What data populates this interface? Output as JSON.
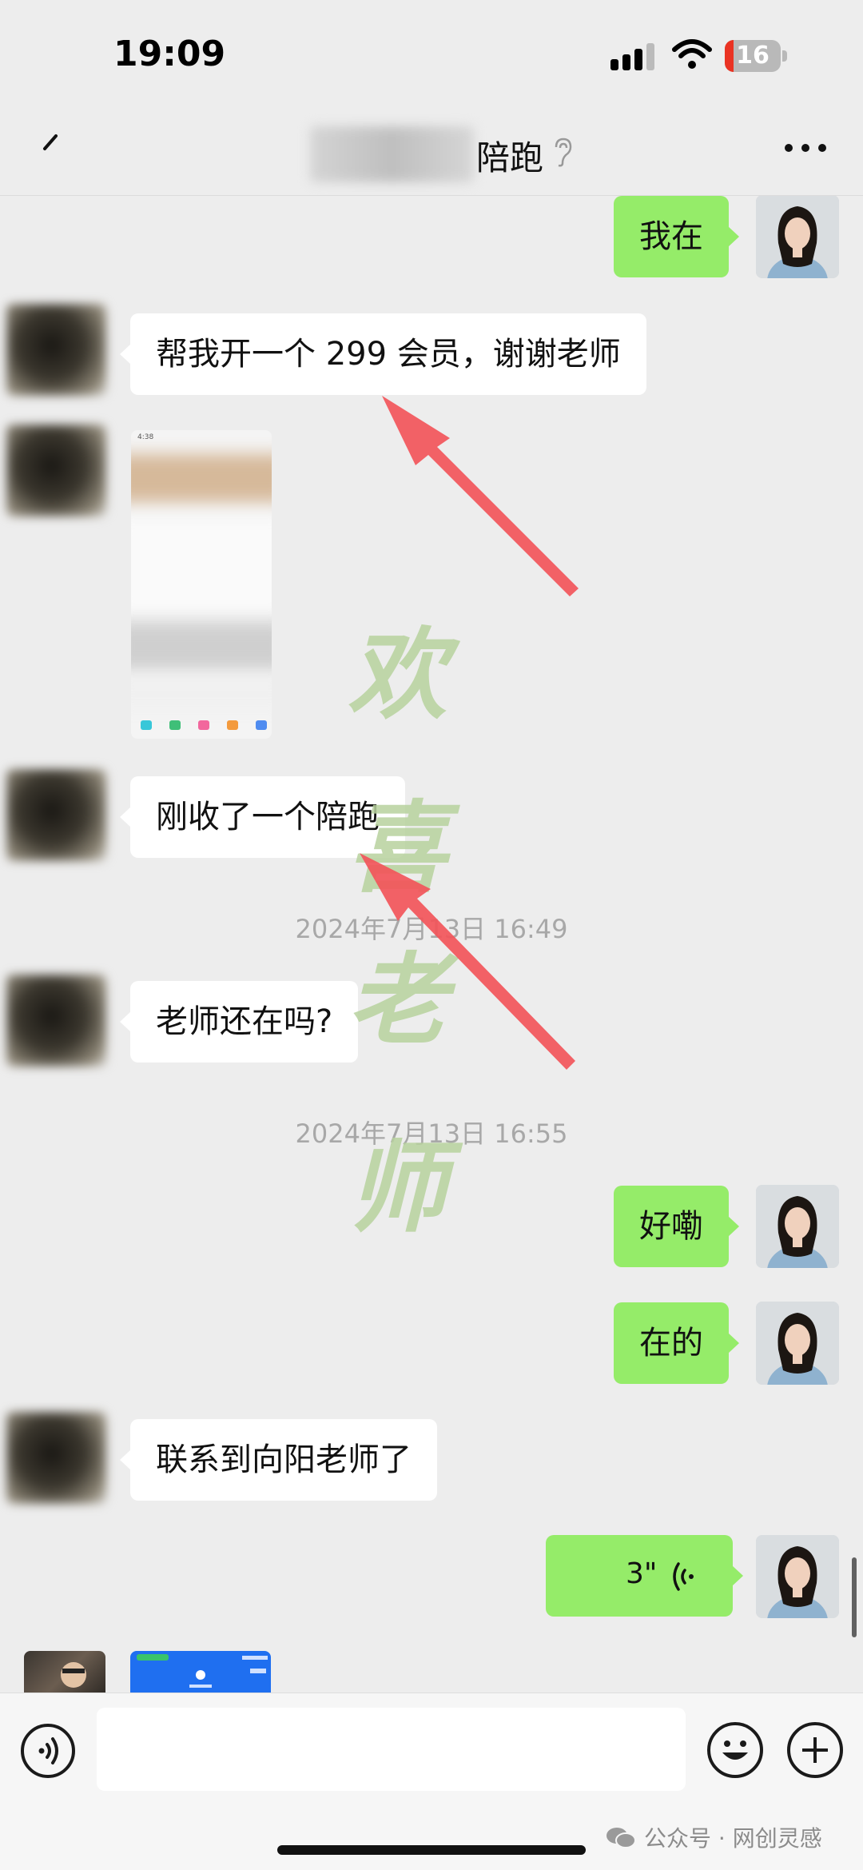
{
  "status_bar": {
    "time": "19:09",
    "battery_level": "16",
    "battery_fraction": 0.16
  },
  "nav": {
    "title": "陪跑",
    "back_icon": "back-icon",
    "more_icon": "more-icon",
    "ear_icon": "ear-icon"
  },
  "messages": [
    {
      "side": "out",
      "type": "text",
      "text": "我在"
    },
    {
      "side": "in",
      "type": "text",
      "text": "帮我开一个 299 会员，谢谢老师"
    },
    {
      "side": "in",
      "type": "image",
      "mini_time": "4:38"
    },
    {
      "side": "in",
      "type": "text",
      "text": "刚收了一个陪跑"
    },
    {
      "type": "timestamp",
      "text": "2024年7月13日 16:49"
    },
    {
      "side": "in",
      "type": "text",
      "text": "老师还在吗?"
    },
    {
      "type": "timestamp",
      "text": "2024年7月13日 16:55"
    },
    {
      "side": "out",
      "type": "text",
      "text": "好嘞"
    },
    {
      "side": "out",
      "type": "text",
      "text": "在的"
    },
    {
      "side": "in",
      "type": "text",
      "text": "联系到向阳老师了"
    },
    {
      "side": "out",
      "type": "voice",
      "duration": "3\""
    }
  ],
  "watermark": [
    "欢",
    "喜",
    "老",
    "师"
  ],
  "input_bar": {
    "voice_icon": "voice-toggle-icon",
    "emoji_icon": "emoji-icon",
    "plus_icon": "plus-icon",
    "footer_watermark": "公众号 · 网创灵感"
  },
  "colors": {
    "background": "#ededed",
    "outgoing_bubble": "#95ec69",
    "incoming_bubble": "#ffffff",
    "arrow": "#f2555a",
    "battery": "#ea3323"
  }
}
